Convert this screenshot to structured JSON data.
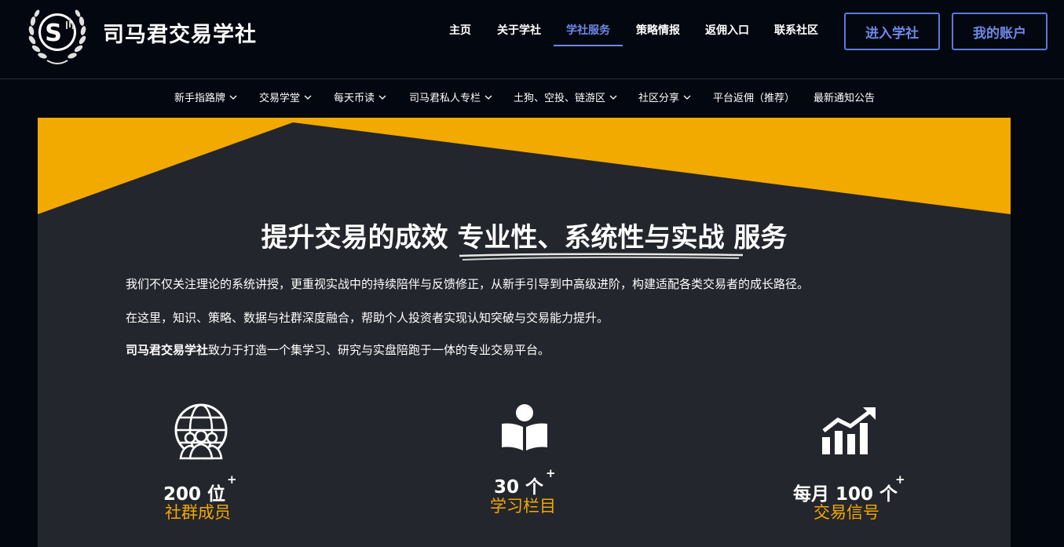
{
  "brand": {
    "name": "司马君交易学社",
    "logo_letter": "S"
  },
  "main_nav": [
    {
      "label": "主页",
      "active": false
    },
    {
      "label": "关于学社",
      "active": false
    },
    {
      "label": "学社服务",
      "active": true
    },
    {
      "label": "策略情报",
      "active": false
    },
    {
      "label": "返佣入口",
      "active": false
    },
    {
      "label": "联系社区",
      "active": false
    }
  ],
  "actions": {
    "enter_label": "进入学社",
    "account_label": "我的账户"
  },
  "sub_nav": [
    {
      "label": "新手指路牌",
      "dropdown": true
    },
    {
      "label": "交易学堂",
      "dropdown": true
    },
    {
      "label": "每天币读",
      "dropdown": true
    },
    {
      "label": "司马君私人专栏",
      "dropdown": true
    },
    {
      "label": "土狗、空投、链游区",
      "dropdown": true
    },
    {
      "label": "社区分享",
      "dropdown": true
    },
    {
      "label": "平台返佣（推荐）",
      "dropdown": false
    },
    {
      "label": "最新通知公告",
      "dropdown": false
    }
  ],
  "hero": {
    "title_prefix": "提升交易的成效 ",
    "title_highlight": "专业性、系统性与实战",
    "title_suffix": " 服务",
    "paragraph_1": "我们不仅关注理论的系统讲授，更重视实战中的持续陪伴与反馈修正，从新手引导到中高级进阶，构建适配各类交易者的成长路径。",
    "paragraph_2": "在这里，知识、策略、数据与社群深度融合，帮助个人投资者实现认知突破与交易能力提升。",
    "paragraph_3_bold": "司马君交易学社",
    "paragraph_3_rest": "致力于打造一个集学习、研究与实盘陪跑于一体的专业交易平台。"
  },
  "stats": [
    {
      "value": "200 位",
      "plus": "+",
      "label": "社群成员",
      "icon": "globe-community-icon"
    },
    {
      "value": "30 个",
      "plus": "+",
      "label": "学习栏目",
      "icon": "reader-book-icon"
    },
    {
      "value": "每月 100 个",
      "plus": "+",
      "label": "交易信号",
      "icon": "growth-chart-icon"
    }
  ],
  "colors": {
    "background": "#03070f",
    "panel": "#24262d",
    "accent_yellow": "#f2a900",
    "accent_blue": "#6f88e6"
  }
}
